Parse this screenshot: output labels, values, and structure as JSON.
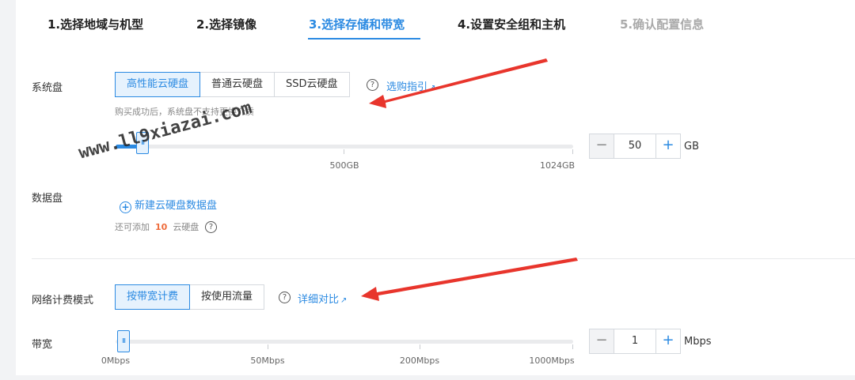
{
  "steps": [
    {
      "label": "1.选择地域与机型",
      "state": "done"
    },
    {
      "label": "2.选择镜像",
      "state": "done"
    },
    {
      "label": "3.选择存储和带宽",
      "state": "active"
    },
    {
      "label": "4.设置安全组和主机",
      "state": "todo"
    },
    {
      "label": "5.确认配置信息",
      "state": "disabled"
    }
  ],
  "system_disk": {
    "label": "系统盘",
    "types": [
      "高性能云硬盘",
      "普通云硬盘",
      "SSD云硬盘"
    ],
    "selected": "高性能云硬盘",
    "guide_link": "选购指引",
    "note": "购买成功后，系统盘不支持更换介质",
    "slider": {
      "min": 0,
      "max": 1024,
      "value": 50,
      "ticks": [
        "500GB",
        "1024GB"
      ]
    },
    "value": "50",
    "unit": "GB"
  },
  "data_disk": {
    "label": "数据盘",
    "add_link": "新建云硬盘数据盘",
    "remaining_prefix": "还可添加",
    "remaining_count": "10",
    "remaining_suffix": "云硬盘"
  },
  "network": {
    "label": "网络计费模式",
    "modes": [
      "按带宽计费",
      "按使用流量"
    ],
    "selected": "按带宽计费",
    "compare_link": "详细对比"
  },
  "bandwidth": {
    "label": "带宽",
    "slider": {
      "value": 1,
      "ticks": [
        "0Mbps",
        "50Mbps",
        "200Mbps",
        "1000Mbps"
      ]
    },
    "value": "1",
    "unit": "Mbps"
  },
  "watermark": "www.ll9xiazai.com",
  "colors": {
    "accent": "#2b8ae2",
    "arrow": "#e8352c",
    "count": "#ee6b3b"
  }
}
